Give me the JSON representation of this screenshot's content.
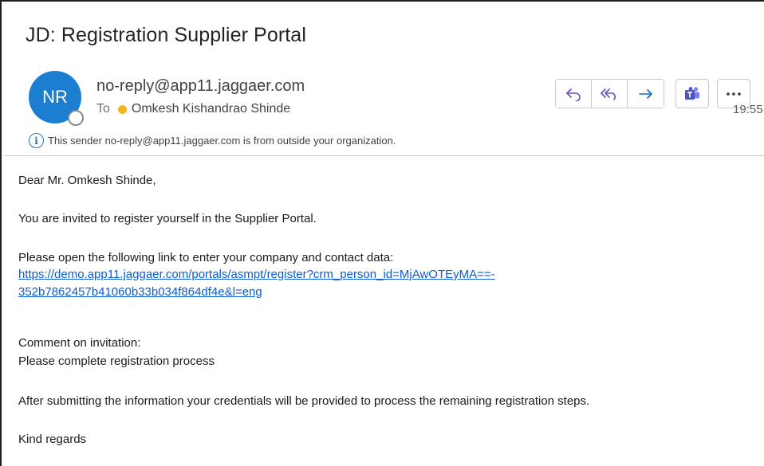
{
  "email": {
    "subject": "JD: Registration Supplier Portal",
    "avatar_initials": "NR",
    "sender": "no-reply@app11.jaggaer.com",
    "to_label": "To",
    "recipient": "Omkesh Kishandrao Shinde",
    "time": "19:55",
    "external_notice": "This sender no-reply@app11.jaggaer.com is from outside your organization."
  },
  "toolbar": {
    "reply": "reply-icon",
    "reply_all": "reply-all-icon",
    "forward": "forward-icon",
    "teams": "teams-icon",
    "more": "more-icon"
  },
  "body": {
    "greeting": "Dear Mr. Omkesh Shinde,",
    "invite": "You are invited to register yourself in the Supplier Portal.",
    "instruction": "Please open the following link to enter your company and contact data:",
    "link_line1": "https://demo.app11.jaggaer.com/portals/asmpt/register?crm_person_id=MjAwOTEyMA==-",
    "link_line2": "352b7862457b41060b33b034f864df4e&l=eng",
    "comment_label": "Comment on invitation:",
    "comment": "Please complete registration process",
    "after_submit": "After submitting the information your credentials will be provided to process the remaining registration steps.",
    "closing": "Kind regards"
  },
  "colors": {
    "avatar": "#1b7ed1",
    "accent": "#0f6cbd",
    "link": "#0b5cd5",
    "presence": "#f2b61d",
    "teams": "#5059c9"
  }
}
